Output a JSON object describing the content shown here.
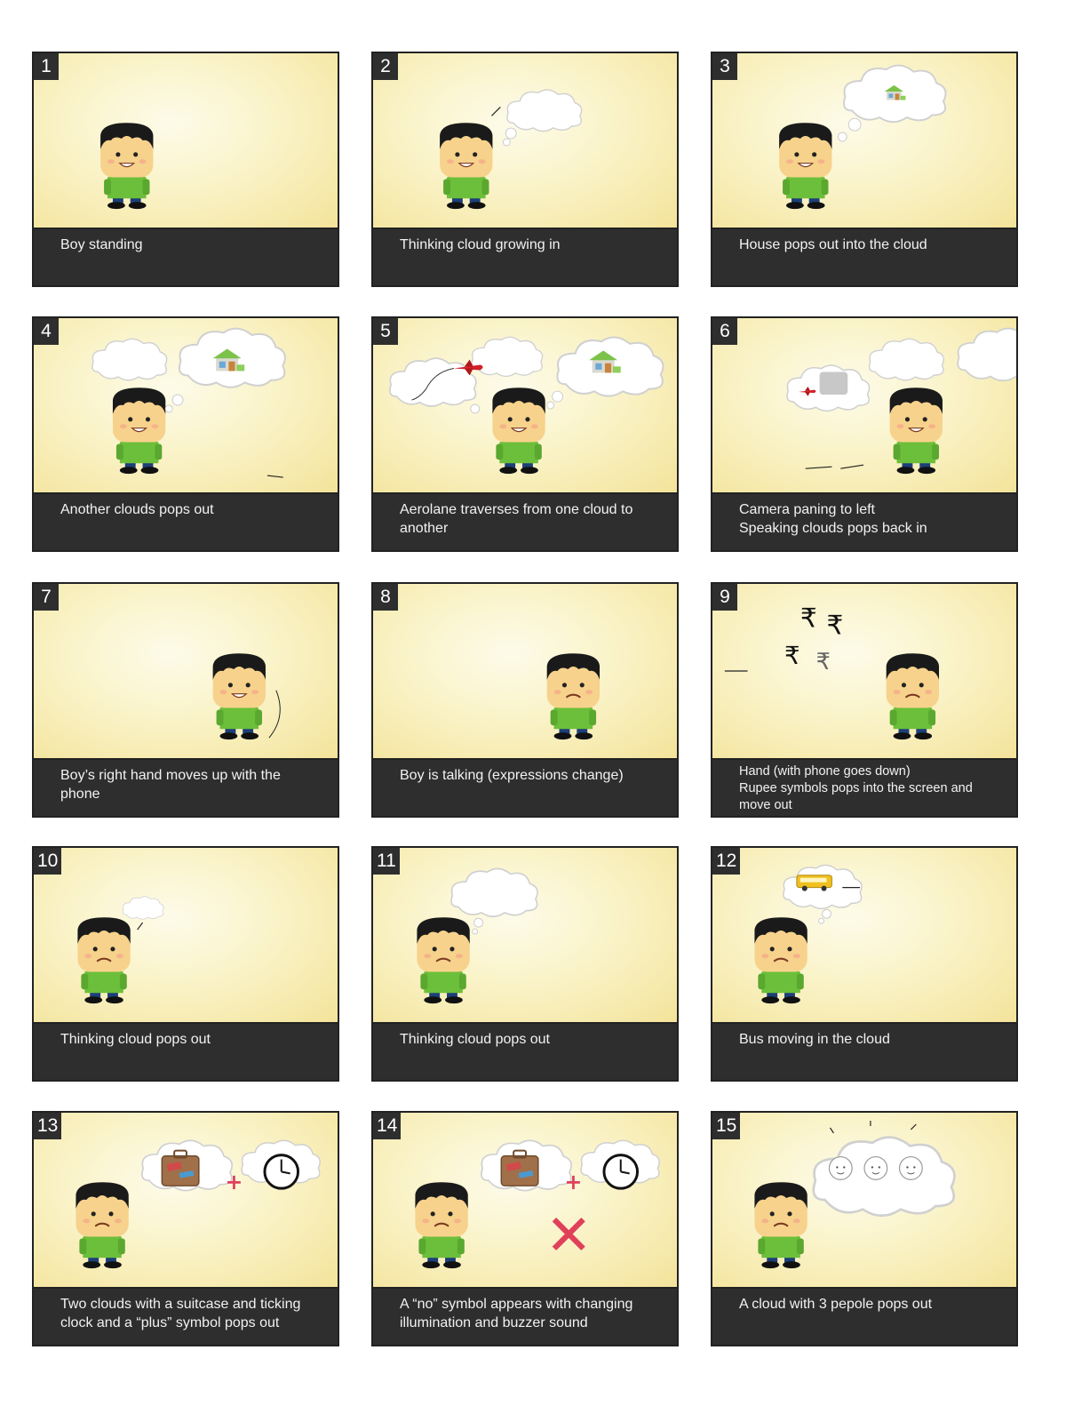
{
  "panels": [
    {
      "number": "1",
      "caption": "Boy standing"
    },
    {
      "number": "2",
      "caption": "Thinking cloud growing in"
    },
    {
      "number": "3",
      "caption": "House pops out into the cloud"
    },
    {
      "number": "4",
      "caption": "Another clouds pops out"
    },
    {
      "number": "5",
      "caption": "Aerolane traverses from one cloud to\nanother"
    },
    {
      "number": "6",
      "caption": "Camera paning to left\nSpeaking clouds pops back in"
    },
    {
      "number": "7",
      "caption": "Boy’s right hand moves up with the\nphone"
    },
    {
      "number": "8",
      "caption": "Boy is talking (expressions change)"
    },
    {
      "number": "9",
      "caption": "Hand (with phone goes down)\nRupee symbols pops into the screen and\nmove out"
    },
    {
      "number": "10",
      "caption": "Thinking cloud pops out"
    },
    {
      "number": "11",
      "caption": "Thinking cloud pops out"
    },
    {
      "number": "12",
      "caption": "Bus moving in the cloud"
    },
    {
      "number": "13",
      "caption": "Two clouds with a suitcase and ticking\nclock and a “plus” symbol pops out"
    },
    {
      "number": "14",
      "caption": "A “no” symbol appears with changing\nillumination and buzzer sound"
    },
    {
      "number": "15",
      "caption": "A cloud with 3 pepole pops out"
    }
  ],
  "symbols": {
    "rupee": "₹",
    "plus": "+",
    "no": "✕"
  },
  "colors": {
    "panel_dark": "#2e2e2e",
    "shirt_green": "#6cbf3a",
    "skin": "#f7d28c",
    "hair": "#1a1a1a",
    "no_symbol_red": "#e0405a",
    "airplane_red": "#d0202a",
    "bus_yellow": "#f0c020"
  }
}
